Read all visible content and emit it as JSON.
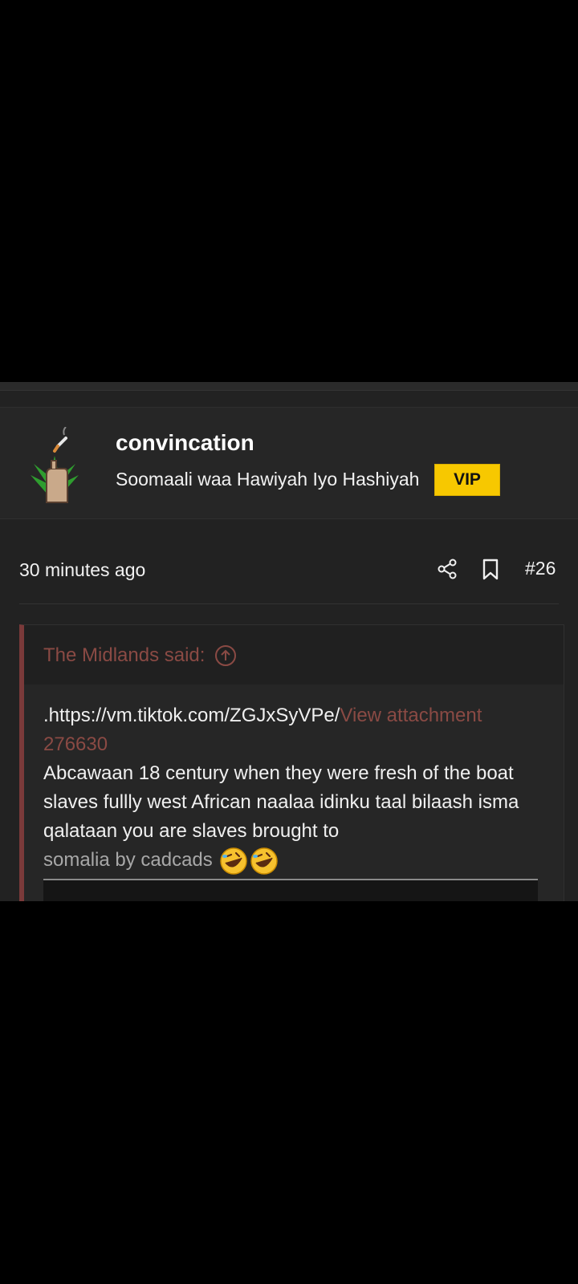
{
  "post": {
    "username": "convincation",
    "user_title": "Soomaali waa Hawiyah Iyo Hashiyah",
    "badge": "VIP",
    "time_ago": "30 minutes ago",
    "post_number": "#26"
  },
  "quote": {
    "author_label": "The Midlands said:",
    "url_text": ".https://vm.tiktok.com/ZGJxSyVPe/",
    "attachment_text": "View attachment 276630",
    "body_text": "Abcawaan 18 century when they were fresh of the boat slaves fullly west African naalaa idinku taal bilaash isma qalataan you are slaves brought to",
    "faded_text": "somalia by cadcads"
  },
  "icons": {
    "share": "share-icon",
    "bookmark": "bookmark-icon",
    "jump": "arrow-up-circle-icon",
    "emoji": "rolling-on-floor-laughing-emoji"
  },
  "colors": {
    "background": "#000000",
    "panel": "#222222",
    "vip_badge": "#f7c800",
    "quote_accent": "#7a3a3a",
    "link": "#8a4a44"
  }
}
